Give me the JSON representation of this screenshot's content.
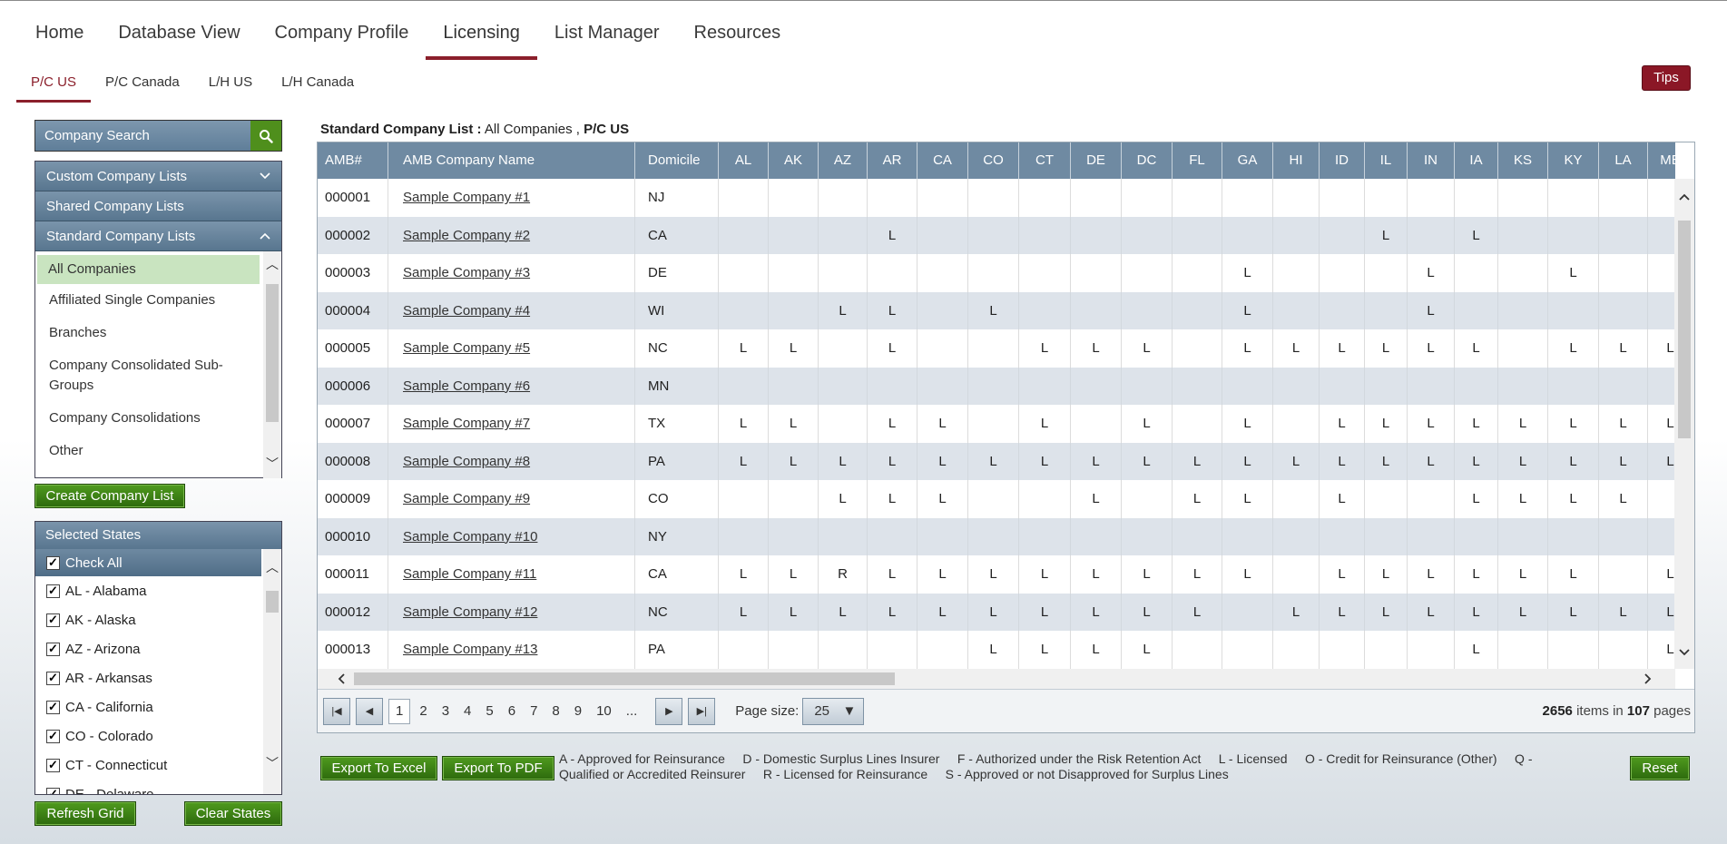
{
  "nav": {
    "items": [
      "Home",
      "Database View",
      "Company Profile",
      "Licensing",
      "List Manager",
      "Resources"
    ],
    "active": "Licensing"
  },
  "subnav": {
    "items": [
      "P/C US",
      "P/C Canada",
      "L/H US",
      "L/H Canada"
    ],
    "active": "P/C US"
  },
  "tips_label": "Tips",
  "search": {
    "placeholder": "Company Search",
    "icon": "search-icon"
  },
  "lists": {
    "custom": "Custom Company Lists",
    "shared": "Shared Company Lists",
    "standard": "Standard Company Lists",
    "items": [
      "All Companies",
      "Affiliated Single Companies",
      "Branches",
      "Company Consolidated Sub-Groups",
      "Company Consolidations",
      "Other"
    ],
    "selected": "All Companies"
  },
  "create_list_label": "Create Company List",
  "states": {
    "header": "Selected States",
    "check_all": "Check All",
    "items": [
      "AL - Alabama",
      "AK - Alaska",
      "AZ - Arizona",
      "AR - Arkansas",
      "CA - California",
      "CO - Colorado",
      "CT - Connecticut",
      "DE - Delaware"
    ]
  },
  "refresh_label": "Refresh Grid",
  "clear_label": "Clear States",
  "grid": {
    "title_bold": "Standard Company List :",
    "title_list": "All Companies ,",
    "title_type": "P/C US",
    "columns": [
      "AMB#",
      "AMB Company Name",
      "Domicile",
      "AL",
      "AK",
      "AZ",
      "AR",
      "CA",
      "CO",
      "CT",
      "DE",
      "DC",
      "FL",
      "GA",
      "HI",
      "ID",
      "IL",
      "IN",
      "IA",
      "KS",
      "KY",
      "LA",
      "ME"
    ],
    "rows": [
      [
        "000001",
        "Sample Company #1",
        "NJ",
        "",
        "",
        "",
        "",
        "",
        "",
        "",
        "",
        "",
        "",
        "",
        "",
        "",
        "",
        "",
        "",
        "",
        "",
        "",
        ""
      ],
      [
        "000002",
        "Sample Company #2",
        "CA",
        "",
        "",
        "",
        "L",
        "",
        "",
        "",
        "",
        "",
        "",
        "",
        "",
        "",
        "L",
        "",
        "L",
        "",
        "",
        "",
        ""
      ],
      [
        "000003",
        "Sample Company #3",
        "DE",
        "",
        "",
        "",
        "",
        "",
        "",
        "",
        "",
        "",
        "",
        "L",
        "",
        "",
        "",
        "L",
        "",
        "",
        "L",
        "",
        ""
      ],
      [
        "000004",
        "Sample Company #4",
        "WI",
        "",
        "",
        "L",
        "L",
        "",
        "L",
        "",
        "",
        "",
        "",
        "L",
        "",
        "",
        "",
        "L",
        "",
        "",
        "",
        "",
        ""
      ],
      [
        "000005",
        "Sample Company #5",
        "NC",
        "L",
        "L",
        "",
        "L",
        "",
        "",
        "L",
        "L",
        "L",
        "",
        "L",
        "L",
        "L",
        "L",
        "L",
        "L",
        "",
        "L",
        "L",
        "L"
      ],
      [
        "000006",
        "Sample Company #6",
        "MN",
        "",
        "",
        "",
        "",
        "",
        "",
        "",
        "",
        "",
        "",
        "",
        "",
        "",
        "",
        "",
        "",
        "",
        "",
        "",
        ""
      ],
      [
        "000007",
        "Sample Company #7",
        "TX",
        "L",
        "L",
        "",
        "L",
        "L",
        "",
        "L",
        "",
        "L",
        "",
        "L",
        "",
        "L",
        "L",
        "L",
        "L",
        "L",
        "L",
        "L",
        "L"
      ],
      [
        "000008",
        "Sample Company #8",
        "PA",
        "L",
        "L",
        "L",
        "L",
        "L",
        "L",
        "L",
        "L",
        "L",
        "L",
        "L",
        "L",
        "L",
        "L",
        "L",
        "L",
        "L",
        "L",
        "L",
        "L"
      ],
      [
        "000009",
        "Sample Company #9",
        "CO",
        "",
        "",
        "L",
        "L",
        "L",
        "",
        "",
        "L",
        "",
        "L",
        "L",
        "",
        "L",
        "",
        "",
        "L",
        "L",
        "L",
        "L",
        ""
      ],
      [
        "000010",
        "Sample Company #10",
        "NY",
        "",
        "",
        "",
        "",
        "",
        "",
        "",
        "",
        "",
        "",
        "",
        "",
        "",
        "",
        "",
        "",
        "",
        "",
        "",
        ""
      ],
      [
        "000011",
        "Sample Company #11",
        "CA",
        "L",
        "L",
        "R",
        "L",
        "L",
        "L",
        "L",
        "L",
        "L",
        "L",
        "L",
        "",
        "L",
        "L",
        "L",
        "L",
        "L",
        "L",
        "",
        "L"
      ],
      [
        "000012",
        "Sample Company #12",
        "NC",
        "L",
        "L",
        "L",
        "L",
        "L",
        "L",
        "L",
        "L",
        "L",
        "L",
        "",
        "L",
        "L",
        "L",
        "L",
        "L",
        "L",
        "L",
        "L",
        "L"
      ],
      [
        "000013",
        "Sample Company #13",
        "PA",
        "",
        "",
        "",
        "",
        "",
        "L",
        "L",
        "L",
        "L",
        "",
        "",
        "",
        "",
        "",
        "",
        "L",
        "",
        "",
        "",
        "L"
      ]
    ]
  },
  "pager": {
    "pages": [
      "1",
      "2",
      "3",
      "4",
      "5",
      "6",
      "7",
      "8",
      "9",
      "10",
      "..."
    ],
    "current": "1",
    "page_size_label": "Page size:",
    "page_size": "25",
    "total_items": "2656",
    "items_in": "items in",
    "total_pages": "107",
    "pages_word": "pages"
  },
  "export_excel_label": "Export To Excel",
  "export_pdf_label": "Export To PDF",
  "legend_line1": "A - Approved for Reinsurance     D - Domestic Surplus Lines Insurer     F - Authorized under the Risk Retention Act     L - Licensed     O - Credit for Reinsurance (Other)     Q -",
  "legend_line2": "Qualified or Accredited Reinsurer     R - Licensed for Reinsurance     S - Approved or not Disapproved for Surplus Lines",
  "reset_label": "Reset",
  "colors": {
    "accent": "#8b1f2b",
    "header": "#6f8aa2",
    "button": "#3f851a"
  }
}
